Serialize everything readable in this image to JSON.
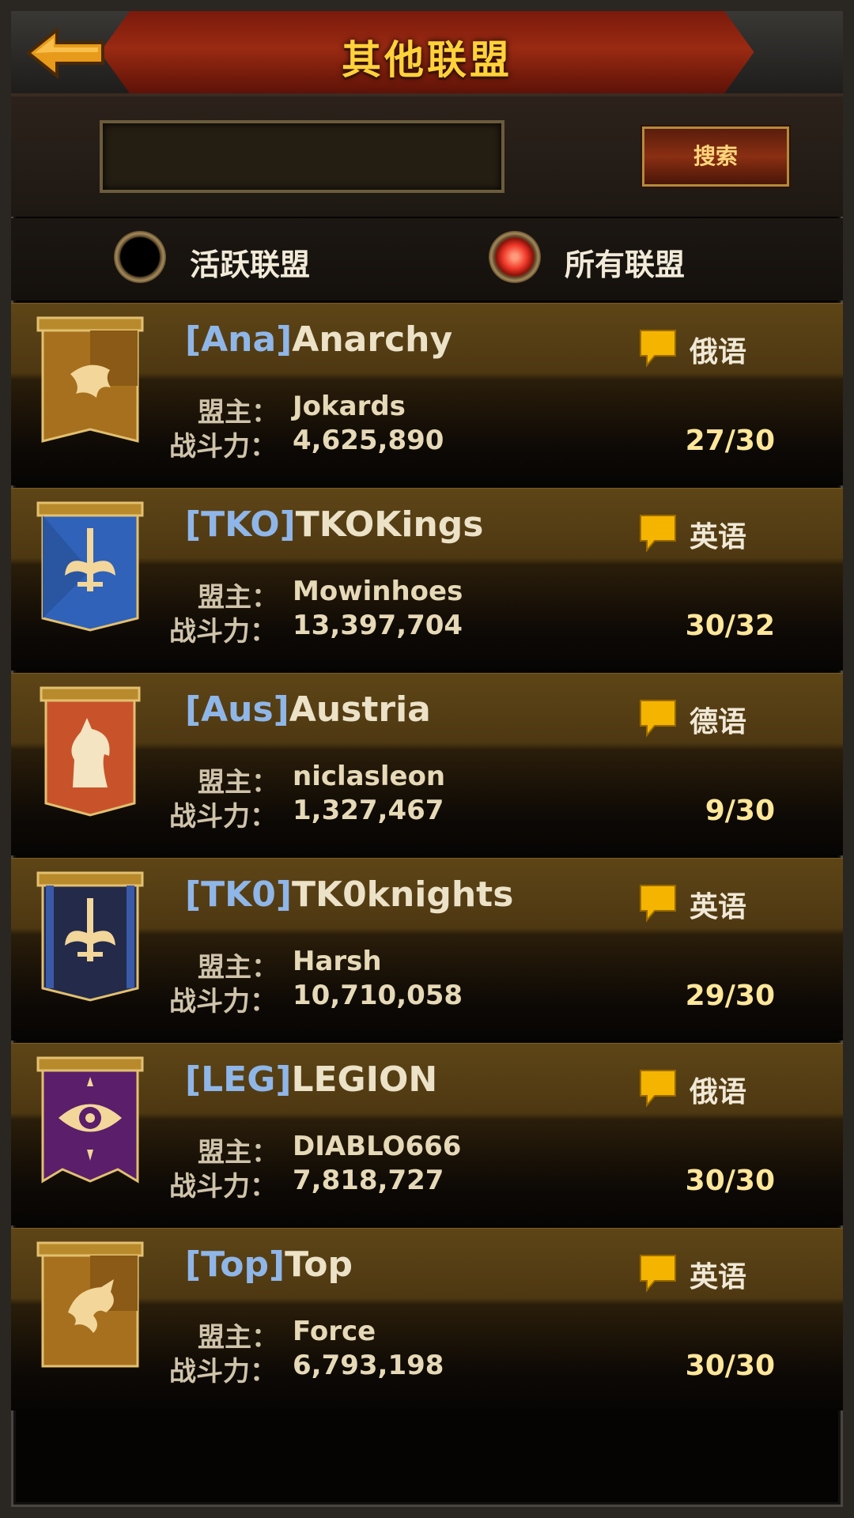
{
  "header": {
    "title": "其他联盟"
  },
  "search": {
    "placeholder": "",
    "value": "",
    "button_label": "搜索"
  },
  "filters": [
    {
      "label": "活跃联盟",
      "selected": false
    },
    {
      "label": "所有联盟",
      "selected": true
    }
  ],
  "labels": {
    "leader": "盟主：",
    "power": "战斗力："
  },
  "colors": {
    "accent_gold": "#ffd23a",
    "tag_blue": "#8fb6e8",
    "chat_yellow": "#f5b400"
  },
  "alliances": [
    {
      "tag": "[Ana]",
      "name": "Anarchy",
      "language": "俄语",
      "leader": "Jokards",
      "power": "4,625,890",
      "members": "27/30",
      "banner": "gold-lion"
    },
    {
      "tag": "[TKO]",
      "name": "TKOKings",
      "language": "英语",
      "leader": "Mowinhoes",
      "power": "13,397,704",
      "members": "30/32",
      "banner": "blue-sword"
    },
    {
      "tag": "[Aus]",
      "name": "Austria",
      "language": "德语",
      "leader": "niclasleon",
      "power": "1,327,467",
      "members": "9/30",
      "banner": "orange-horse"
    },
    {
      "tag": "[TK0]",
      "name": "TK0knights",
      "language": "英语",
      "leader": "Harsh",
      "power": "10,710,058",
      "members": "29/30",
      "banner": "navy-sword"
    },
    {
      "tag": "[LEG]",
      "name": "LEGION",
      "language": "俄语",
      "leader": "DIABLO666",
      "power": "7,818,727",
      "members": "30/30",
      "banner": "purple-eye"
    },
    {
      "tag": "[Top]",
      "name": "Top",
      "language": "英语",
      "leader": "Force",
      "power": "6,793,198",
      "members": "30/30",
      "banner": "gold-dragon"
    }
  ]
}
